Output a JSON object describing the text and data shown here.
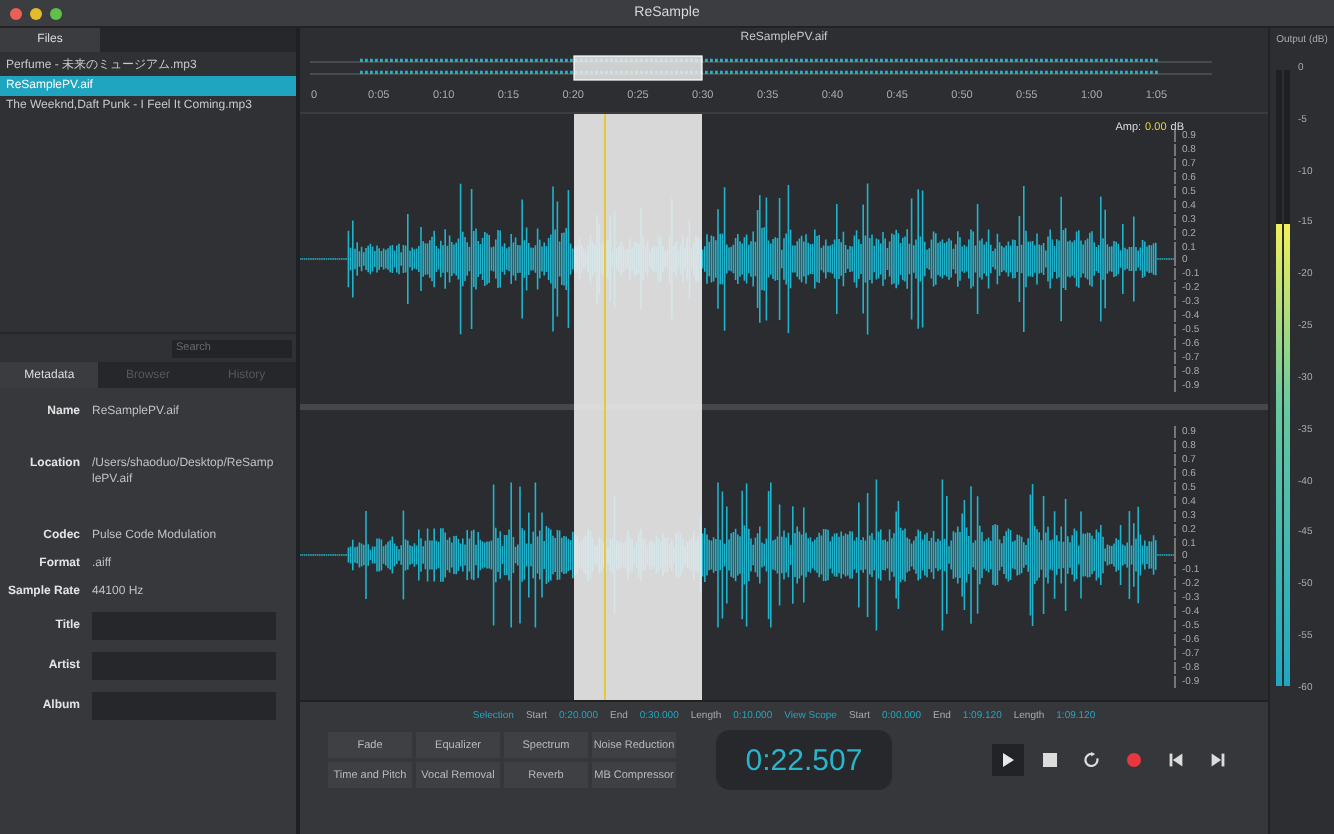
{
  "window": {
    "title": "ReSample"
  },
  "sidebar": {
    "tab": "Files",
    "files": [
      {
        "name": "Perfume - 未来のミュージアム.mp3",
        "selected": false
      },
      {
        "name": "ReSamplePV.aif",
        "selected": true
      },
      {
        "name": "The Weeknd,Daft Punk - I Feel It Coming.mp3",
        "selected": false
      }
    ],
    "search": {
      "placeholder": "Search"
    },
    "tabs": [
      {
        "label": "Metadata",
        "selected": true
      },
      {
        "label": "Browser",
        "selected": false
      },
      {
        "label": "History",
        "selected": false
      }
    ],
    "metadata": [
      {
        "kind": "text",
        "label": "Name",
        "value": "ReSamplePV.aif"
      },
      {
        "kind": "text",
        "label": "Location",
        "value": "/Users/shaoduo/Desktop/ReSamplePV.aif"
      },
      {
        "kind": "text",
        "label": "Codec",
        "value": "Pulse Code Modulation"
      },
      {
        "kind": "text",
        "label": "Format",
        "value": ".aiff"
      },
      {
        "kind": "text",
        "label": "Sample Rate",
        "value": "44100 Hz"
      },
      {
        "kind": "input",
        "label": "Title"
      },
      {
        "kind": "input",
        "label": "Artist"
      },
      {
        "kind": "input",
        "label": "Album"
      }
    ]
  },
  "editor": {
    "title": "ReSamplePV.aif",
    "time_ticks": [
      "0",
      "0:05",
      "0:10",
      "0:15",
      "0:20",
      "0:25",
      "0:30",
      "0:35",
      "0:40",
      "0:45",
      "0:50",
      "0:55",
      "1:00",
      "1:05"
    ],
    "amp": {
      "label": "Amp:",
      "value": "0.00",
      "unit": "dB"
    },
    "channels": [
      {
        "amp_scale": [
          "0.9",
          "0.8",
          "0.7",
          "0.6",
          "0.5",
          "0.4",
          "0.3",
          "0.2",
          "0.1",
          "0",
          "-0.1",
          "-0.2",
          "-0.3",
          "-0.4",
          "-0.5",
          "-0.6",
          "-0.7",
          "-0.8",
          "-0.9"
        ]
      },
      {
        "amp_scale": [
          "0.9",
          "0.8",
          "0.7",
          "0.6",
          "0.5",
          "0.4",
          "0.3",
          "0.2",
          "0.1",
          "0",
          "-0.1",
          "-0.2",
          "-0.3",
          "-0.4",
          "-0.5",
          "-0.6",
          "-0.7",
          "-0.8",
          "-0.9"
        ]
      }
    ]
  },
  "meter": {
    "title": "Output (dB)",
    "scale": [
      "0",
      "-5",
      "-10",
      "-15",
      "-20",
      "-25",
      "-30",
      "-35",
      "-40",
      "-45",
      "-50",
      "-55",
      "-60"
    ],
    "bars": [
      {
        "level": 0.75
      },
      {
        "level": 0.75
      }
    ]
  },
  "info": [
    {
      "title": "Selection",
      "fields": [
        {
          "label": "Start",
          "value": "0:20.000"
        },
        {
          "label": "End",
          "value": "0:30.000"
        },
        {
          "label": "Length",
          "value": "0:10.000"
        }
      ]
    },
    {
      "title": "View Scope",
      "fields": [
        {
          "label": "Start",
          "value": "0:00.000"
        },
        {
          "label": "End",
          "value": "1:09.120"
        },
        {
          "label": "Length",
          "value": "1:09.120"
        }
      ]
    }
  ],
  "effects": [
    "Fade",
    "Equalizer",
    "Spectrum",
    "Noise Reduction",
    "Time and Pitch",
    "Vocal Removal",
    "Reverb",
    "MB Compressor"
  ],
  "timer": "0:22.507",
  "transport": [
    {
      "kind": "play",
      "selected": true
    },
    {
      "kind": "stop",
      "selected": false
    },
    {
      "kind": "loop",
      "selected": false
    },
    {
      "kind": "record",
      "selected": false
    },
    {
      "kind": "skip-back",
      "selected": false
    },
    {
      "kind": "skip-forward",
      "selected": false
    }
  ]
}
